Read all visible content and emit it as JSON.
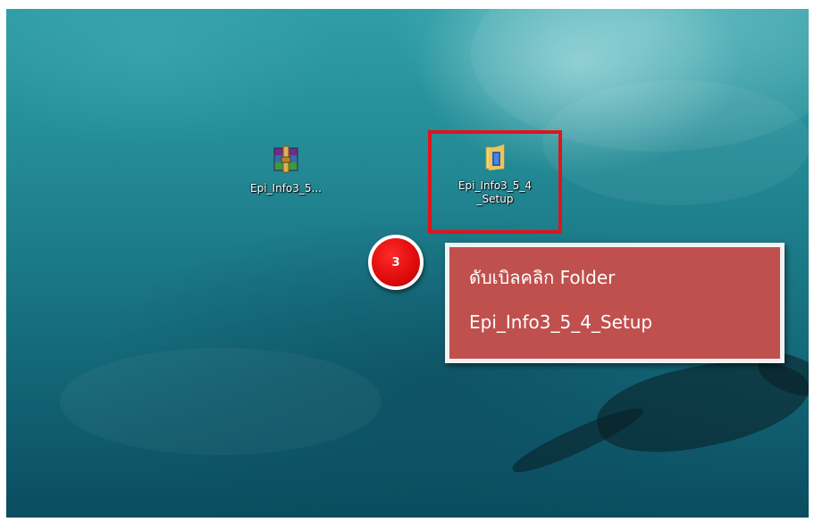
{
  "desktop": {
    "icons": [
      {
        "label": "Epi_Info3_5...",
        "icon": "winrar-archive-icon"
      },
      {
        "label": "Epi_Info3_5_4\n_Setup",
        "icon": "folder-icon"
      }
    ]
  },
  "annotation": {
    "step_number": "3",
    "callout_line1": "ดับเบิลคลิก Folder",
    "callout_line2": "Epi_Info3_5_4_Setup",
    "highlight_color": "#e3131b",
    "callout_color": "#c0504d",
    "badge_color": "#e00d0d"
  }
}
